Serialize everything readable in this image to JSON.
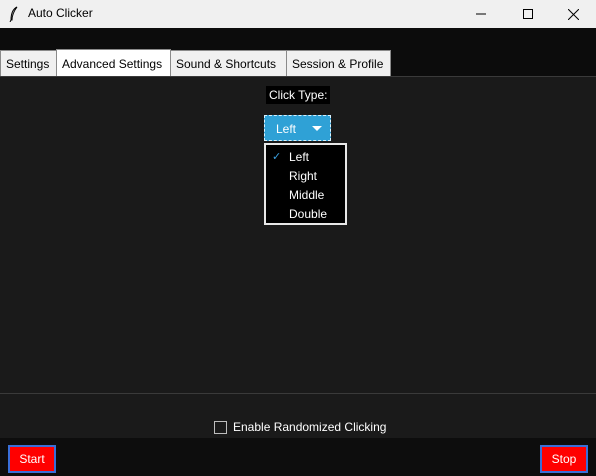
{
  "window": {
    "title": "Auto Clicker",
    "icon": "feather-icon",
    "controls": {
      "minimize": "minimize-icon",
      "maximize": "maximize-icon",
      "close": "close-icon"
    }
  },
  "tabs": [
    "Settings",
    "Advanced Settings",
    "Sound & Shortcuts",
    "Session & Profile"
  ],
  "active_tab": "Advanced Settings",
  "click_type": {
    "label": "Click Type:",
    "selected": "Left",
    "options": [
      "Left",
      "Right",
      "Middle",
      "Double"
    ],
    "check_mark": "✓"
  },
  "randomize": {
    "label": "Enable Randomized Clicking",
    "checked": false
  },
  "buttons": {
    "start": "Start",
    "stop": "Stop"
  },
  "colors": {
    "accent": "#2fa1d6",
    "action": "#ff0000",
    "action_border": "#3a6fd8",
    "background": "#1a1a1a"
  }
}
